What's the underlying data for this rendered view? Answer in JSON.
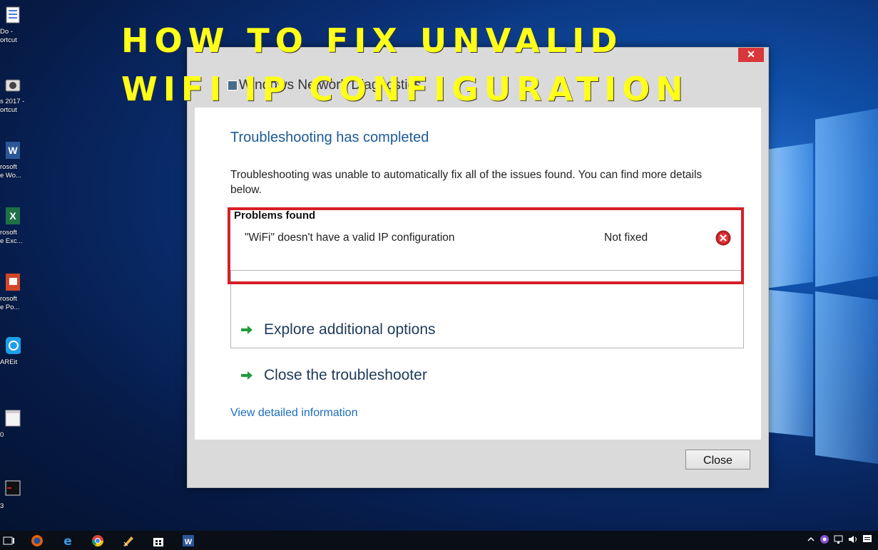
{
  "overlay": {
    "line1": "HOW TO FIX UNVALID",
    "line2": "WIFI IP CONFIGURATION",
    "color": "#ffff1a"
  },
  "desktop_icons": [
    {
      "label1": "Do -",
      "label2": "ortcut",
      "icon": "todo-icon"
    },
    {
      "label1": "s 2017 -",
      "label2": "ortcut",
      "icon": "camera-icon"
    },
    {
      "label1": "rosoft",
      "label2": "e Wo...",
      "icon": "word-icon"
    },
    {
      "label1": "rosoft",
      "label2": "e Exc...",
      "icon": "excel-icon"
    },
    {
      "label1": "rosoft",
      "label2": "e Po...",
      "icon": "powerpoint-icon"
    },
    {
      "label1": "AREit",
      "label2": "",
      "icon": "shareit-icon"
    },
    {
      "label1": "0",
      "label2": "",
      "icon": "folder-icon"
    },
    {
      "label1": "3",
      "label2": "",
      "icon": "app-icon"
    }
  ],
  "window": {
    "title": "Windows Network Diagnostics",
    "close_glyph": "✕",
    "heading": "Troubleshooting has completed",
    "description": "Troubleshooting was unable to automatically fix all of the issues found. You can find more details below.",
    "problems_title": "Problems found",
    "problems": [
      {
        "text": "\"WiFi\" doesn't have a valid IP configuration",
        "status": "Not fixed",
        "icon": "error-icon"
      }
    ],
    "options": [
      {
        "label": "Explore additional options",
        "icon": "green-arrow-icon"
      },
      {
        "label": "Close the troubleshooter",
        "icon": "green-arrow-icon"
      }
    ],
    "details_link": "View detailed information",
    "close_button": "Close",
    "colors": {
      "heading": "#1c5b96",
      "highlight": "#d61f26",
      "link": "#1c6dbd"
    }
  },
  "taskbar": {
    "icons": [
      "task-view-icon",
      "firefox-icon",
      "edge-icon",
      "chrome-icon",
      "pen-tool-icon",
      "store-icon",
      "word-icon"
    ],
    "tray": [
      "chevron-up-icon",
      "shield-icon",
      "network-icon",
      "volume-icon",
      "notification-icon"
    ]
  }
}
